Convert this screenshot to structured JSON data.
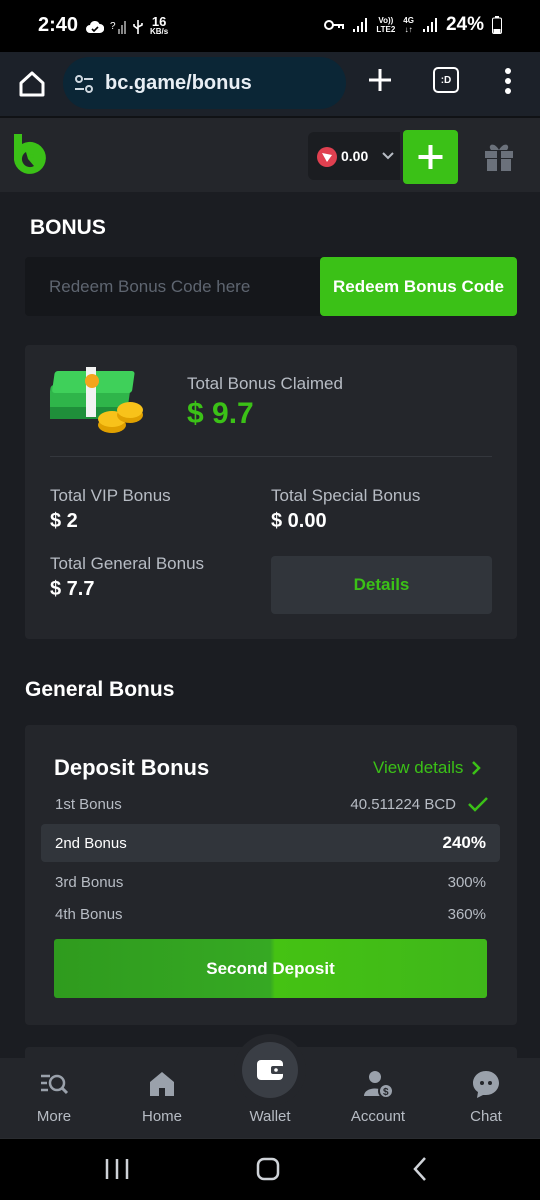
{
  "status_bar": {
    "time": "2:40",
    "speed_value": "16",
    "speed_unit": "KB/s",
    "lte_top": "Vo))",
    "lte_bottom": "LTE2",
    "net": "4G",
    "battery": "24%"
  },
  "browser": {
    "url": "bc.game/bonus",
    "tabs_label": ":D"
  },
  "header": {
    "balance": "0.00",
    "currency_icon": "tron-icon",
    "accent_color": "#3bc117"
  },
  "page": {
    "title": "BONUS",
    "redeem": {
      "placeholder": "Redeem Bonus Code here",
      "button": "Redeem Bonus Code"
    },
    "summary": {
      "claimed_label": "Total Bonus Claimed",
      "claimed_value": "$ 9.7",
      "vip_label": "Total VIP Bonus",
      "vip_value": "$ 2",
      "special_label": "Total Special Bonus",
      "special_value": "$ 0.00",
      "general_label": "Total General Bonus",
      "general_value": "$ 7.7",
      "details_button": "Details"
    },
    "general_bonus": {
      "section_title": "General Bonus",
      "deposit_card": {
        "title": "Deposit Bonus",
        "view_details": "View details",
        "rows": [
          {
            "name": "1st Bonus",
            "value": "40.511224 BCD",
            "completed": true
          },
          {
            "name": "2nd Bonus",
            "value": "240%",
            "active": true
          },
          {
            "name": "3rd Bonus",
            "value": "300%"
          },
          {
            "name": "4th Bonus",
            "value": "360%"
          }
        ],
        "cta": "Second Deposit"
      }
    }
  },
  "bottom_nav": [
    {
      "label": "More",
      "icon": "search-list-icon"
    },
    {
      "label": "Home",
      "icon": "home-icon"
    },
    {
      "label": "Wallet",
      "icon": "wallet-icon"
    },
    {
      "label": "Account",
      "icon": "account-icon"
    },
    {
      "label": "Chat",
      "icon": "chat-icon"
    }
  ]
}
